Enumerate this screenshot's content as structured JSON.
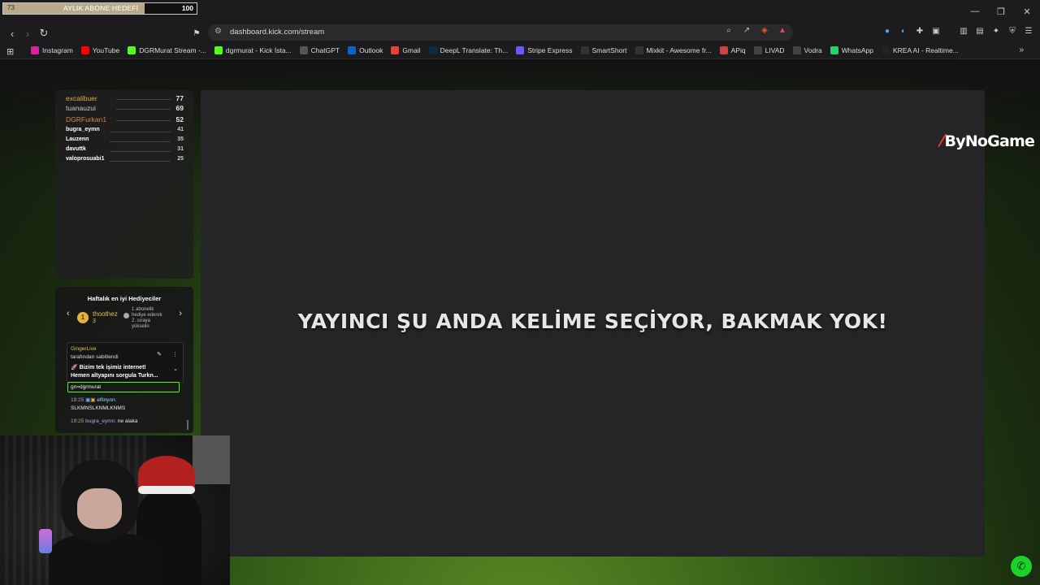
{
  "sub_goal": {
    "current": "73",
    "title": "AYLIK ABONE HEDEFİ",
    "target": "100",
    "progress": 0.73,
    "fill_color": "#b9a98b"
  },
  "window_controls": {
    "minimize": "—",
    "restore": "❐",
    "close": "✕"
  },
  "toolbar": {
    "back": "‹",
    "forward": "›",
    "reload": "↻",
    "bookmark": "⚑",
    "url": "dashboard.kick.com/stream"
  },
  "bookmarks": [
    {
      "label": "Instagram",
      "icon": "instagram-icon",
      "color": "#d6249f"
    },
    {
      "label": "YouTube",
      "icon": "youtube-icon",
      "color": "#ff0000"
    },
    {
      "label": "DGRMurat Stream -...",
      "icon": "kick-icon",
      "color": "#53fc18"
    },
    {
      "label": "dgrmurat - Kick İsta...",
      "icon": "kick-icon",
      "color": "#53fc18"
    },
    {
      "label": "ChatGPT",
      "icon": "chatgpt-icon",
      "color": "#555555"
    },
    {
      "label": "Outlook",
      "icon": "outlook-icon",
      "color": "#0a64c9"
    },
    {
      "label": "Gmail",
      "icon": "gmail-icon",
      "color": "#ea4335"
    },
    {
      "label": "DeepL Translate: Th...",
      "icon": "deepl-icon",
      "color": "#0f2b46"
    },
    {
      "label": "Stripe Express",
      "icon": "stripe-icon",
      "color": "#635bff"
    },
    {
      "label": "SmartShort",
      "icon": "smartshort-icon",
      "color": "#333333"
    },
    {
      "label": "Mixkit - Awesome fr...",
      "icon": "mixkit-icon",
      "color": "#333333"
    },
    {
      "label": "APiq",
      "icon": "apiq-icon",
      "color": "#c44"
    },
    {
      "label": "LIVAD",
      "icon": "livad-icon",
      "color": "#444444"
    },
    {
      "label": "Vodra",
      "icon": "vodra-icon",
      "color": "#444444"
    },
    {
      "label": "WhatsApp",
      "icon": "whatsapp-icon",
      "color": "#25d366"
    },
    {
      "label": "KREA AI - Realtime...",
      "icon": "krea-icon",
      "color": "#222222"
    }
  ],
  "leaderboard": [
    {
      "name": "excalibuer",
      "value": "77",
      "color": "#e0b040"
    },
    {
      "name": "tuanauzui",
      "value": "69",
      "color": "#c0c8d8"
    },
    {
      "name": "DGRFurkan1",
      "value": "52",
      "color": "#d08850"
    },
    {
      "name": "bugra_eymn",
      "value": "41",
      "color": "#ffffff"
    },
    {
      "name": "Lauzenn",
      "value": "35",
      "color": "#ffffff"
    },
    {
      "name": "davuttk",
      "value": "31",
      "color": "#ffffff"
    },
    {
      "name": "valoprosuabi1",
      "value": "25",
      "color": "#ffffff"
    }
  ],
  "gifters": {
    "title": "Haftalık en iyi Hediyeciler",
    "rank": "1",
    "user": "thoothez",
    "count": "3",
    "note_line1": "1 abonelik",
    "note_line2": "hediye ederek",
    "note_line3": "2. sıraya",
    "note_line4": "yükselin"
  },
  "chat": {
    "pinned_by_user": "GingerLive",
    "pinned_by_text": "tarafından sabitlendi",
    "pinned_line1": "🚀 Bizim tek işimiz internet!",
    "pinned_line2": "Hemen altyapını sorgula Turkn...",
    "partial_line": "gn=dgrmurat",
    "msg1_time": "19:25",
    "msg1_user": "elfinyon:",
    "msg1_text": "SLKMNSLKNMLKNMS",
    "msg2_time": "19:25",
    "msg2_user": "bugra_eymn:",
    "msg2_text": "ne alaka"
  },
  "stage": {
    "message": "YAYINCI ŞU ANDA KELİME SEÇİYOR, BAKMAK YOK!"
  },
  "brand": {
    "name": "ByNoGame"
  }
}
